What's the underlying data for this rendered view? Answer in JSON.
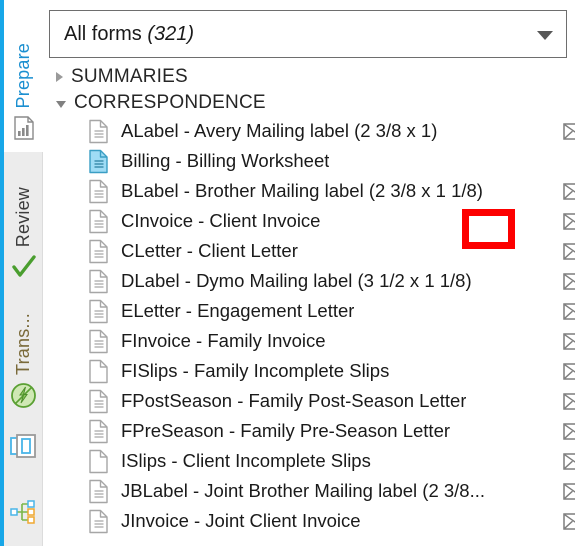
{
  "rail": {
    "accent_color": "#18a7e8",
    "tabs": [
      {
        "label": "Prepare",
        "icon": "document-chart-icon",
        "active": true
      },
      {
        "label": "Review",
        "icon": "green-checkmark-icon",
        "active": false
      },
      {
        "label": "Trans...",
        "icon": "green-transfer-icon",
        "active": false
      }
    ],
    "buttons": [
      {
        "name": "panel-toggle-button",
        "icon": "side-panel-icon"
      },
      {
        "name": "organizer-tree-button",
        "icon": "hierarchy-tree-icon"
      }
    ]
  },
  "dropdown": {
    "name": "all-forms-dropdown",
    "label": "All forms ",
    "count": "(321)",
    "arrow_icon": "chevron-down-icon"
  },
  "tree": {
    "groups": [
      {
        "label": "SUMMARIES",
        "expanded": false
      },
      {
        "label": "CORRESPONDENCE",
        "expanded": true
      }
    ],
    "forms": [
      {
        "label": "ALabel - Avery Mailing label (2 3/8 x 1)",
        "icon": "document-lines-icon",
        "envelope": true
      },
      {
        "label": "Billing - Billing Worksheet",
        "icon": "document-lines-blue-icon",
        "envelope": false
      },
      {
        "label": "BLabel - Brother Mailing label (2 3/8 x 1 1/8)",
        "icon": "document-lines-icon",
        "envelope": true
      },
      {
        "label": "CInvoice - Client Invoice",
        "icon": "document-lines-icon",
        "envelope": true
      },
      {
        "label": "CLetter - Client Letter",
        "icon": "document-lines-icon",
        "envelope": true
      },
      {
        "label": "DLabel - Dymo Mailing label (3 1/2 x 1 1/8)",
        "icon": "document-lines-icon",
        "envelope": true
      },
      {
        "label": "ELetter - Engagement Letter",
        "icon": "document-lines-icon",
        "envelope": true
      },
      {
        "label": "FInvoice - Family Invoice",
        "icon": "document-lines-icon",
        "envelope": true
      },
      {
        "label": "FISlips - Family Incomplete Slips",
        "icon": "document-blank-icon",
        "envelope": true
      },
      {
        "label": "FPostSeason - Family Post-Season Letter",
        "icon": "document-lines-icon",
        "envelope": true
      },
      {
        "label": "FPreSeason - Family Pre-Season Letter",
        "icon": "document-lines-icon",
        "envelope": true
      },
      {
        "label": "ISlips - Client Incomplete Slips",
        "icon": "document-blank-icon",
        "envelope": true
      },
      {
        "label": "JBLabel - Joint Brother Mailing label (2 3/8...",
        "icon": "document-lines-icon",
        "envelope": true
      },
      {
        "label": "JInvoice - Joint Client Invoice",
        "icon": "document-lines-icon",
        "envelope": true
      }
    ]
  },
  "annotation": {
    "name": "highlight-box",
    "color": "#fd0000",
    "target_row": "CInvoice - Client Invoice",
    "target_element": "email-envelope-icon"
  }
}
